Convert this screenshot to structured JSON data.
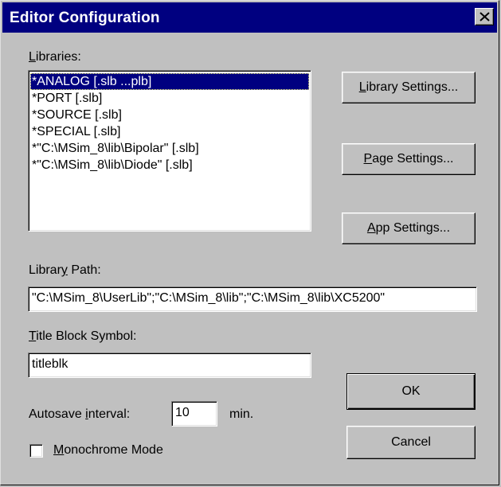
{
  "dialog": {
    "title": "Editor Configuration",
    "close_icon": "close-x-icon"
  },
  "libraries": {
    "label": {
      "ul": "L",
      "rest": "ibraries:"
    },
    "items": [
      {
        "text": "*ANALOG [.slb ...plb]",
        "selected": true
      },
      {
        "text": "*PORT [.slb]",
        "selected": false
      },
      {
        "text": "*SOURCE [.slb]",
        "selected": false
      },
      {
        "text": "*SPECIAL [.slb]",
        "selected": false
      },
      {
        "text": "*\"C:\\MSim_8\\lib\\Bipolar\" [.slb]",
        "selected": false
      },
      {
        "text": "*\"C:\\MSim_8\\lib\\Diode\" [.slb]",
        "selected": false
      }
    ]
  },
  "buttons": {
    "library_settings": {
      "ul": "L",
      "rest": "ibrary Settings..."
    },
    "page_settings": {
      "ul": "P",
      "rest": "age Settings..."
    },
    "app_settings": {
      "ul": "A",
      "rest": "pp Settings..."
    },
    "ok": "OK",
    "cancel": "Cancel"
  },
  "library_path": {
    "label": {
      "pre": "Librar",
      "ul": "y",
      "post": " Path:"
    },
    "value": "\"C:\\MSim_8\\UserLib\";\"C:\\MSim_8\\lib\";\"C:\\MSim_8\\lib\\XC5200\""
  },
  "title_block": {
    "label": {
      "ul": "T",
      "rest": "itle Block Symbol:"
    },
    "value": "titleblk"
  },
  "autosave": {
    "label": {
      "pre": "Autosave ",
      "ul": "i",
      "post": "nterval:"
    },
    "value": "10",
    "unit": "min."
  },
  "monochrome": {
    "label": {
      "ul": "M",
      "rest": "onochrome Mode"
    },
    "checked": false
  },
  "colors": {
    "titlebar": "#000080",
    "face": "#c0c0c0",
    "selection": "#000080"
  }
}
